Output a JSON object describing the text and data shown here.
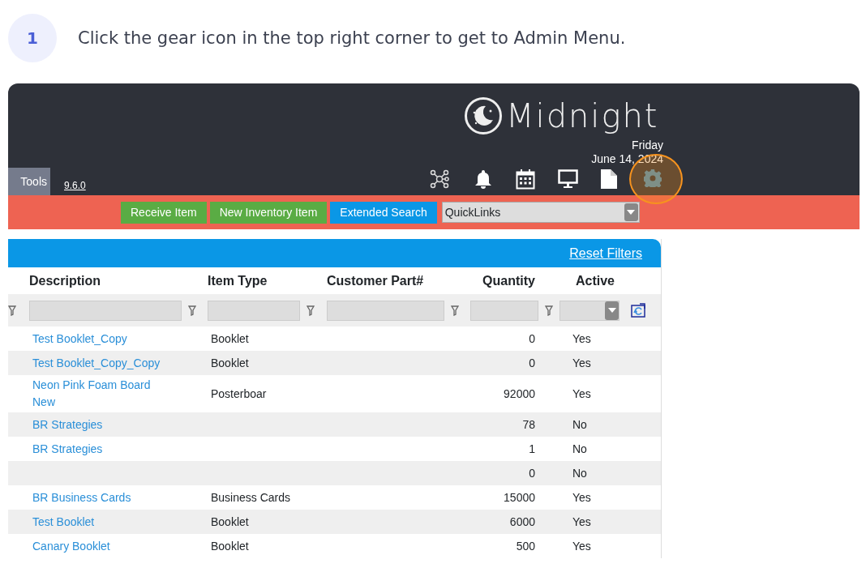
{
  "step": {
    "number": "1",
    "instruction": "Click the gear icon in the top right corner to get to Admin Menu."
  },
  "app": {
    "logo_text": "Midnight",
    "date_day": "Friday",
    "date_full": "June 14, 2024",
    "tools_label": "Tools",
    "version": "9.6.0",
    "actions": [
      {
        "label": "Receive Item",
        "color": "#5aac44"
      },
      {
        "label": "New Inventory Item",
        "color": "#5aac44"
      },
      {
        "label": "Extended Search",
        "color": "#0a97e6"
      }
    ],
    "quicklinks": {
      "value": "QuickLinks"
    },
    "table": {
      "reset_link": "Reset Filters",
      "columns": [
        {
          "label": "Description"
        },
        {
          "label": "Item Type"
        },
        {
          "label": "Customer Part#"
        },
        {
          "label": "Quantity"
        },
        {
          "label": "Active"
        }
      ],
      "rows": [
        {
          "description": "Test Booklet_Copy",
          "item_type": "Booklet",
          "quantity": "0",
          "active": "Yes"
        },
        {
          "description": "Test Booklet_Copy_Copy",
          "item_type": "Booklet",
          "quantity": "0",
          "active": "Yes"
        },
        {
          "description": "Neon Pink Foam Board New",
          "item_type": "Posterboar",
          "quantity": "92000",
          "active": "Yes"
        },
        {
          "description": "BR Strategies",
          "quantity": "78",
          "active": "No"
        },
        {
          "description": "BR Strategies",
          "quantity": "1",
          "active": "No"
        },
        {
          "quantity": "0",
          "active": "No"
        },
        {
          "description": "BR Business Cards",
          "item_type": "Business Cards",
          "quantity": "15000",
          "active": "Yes"
        },
        {
          "description": "Test Booklet",
          "item_type": "Booklet",
          "quantity": "6000",
          "active": "Yes"
        },
        {
          "description": "Canary Booklet",
          "item_type": "Booklet",
          "quantity": "500",
          "active": "Yes"
        }
      ]
    }
  }
}
